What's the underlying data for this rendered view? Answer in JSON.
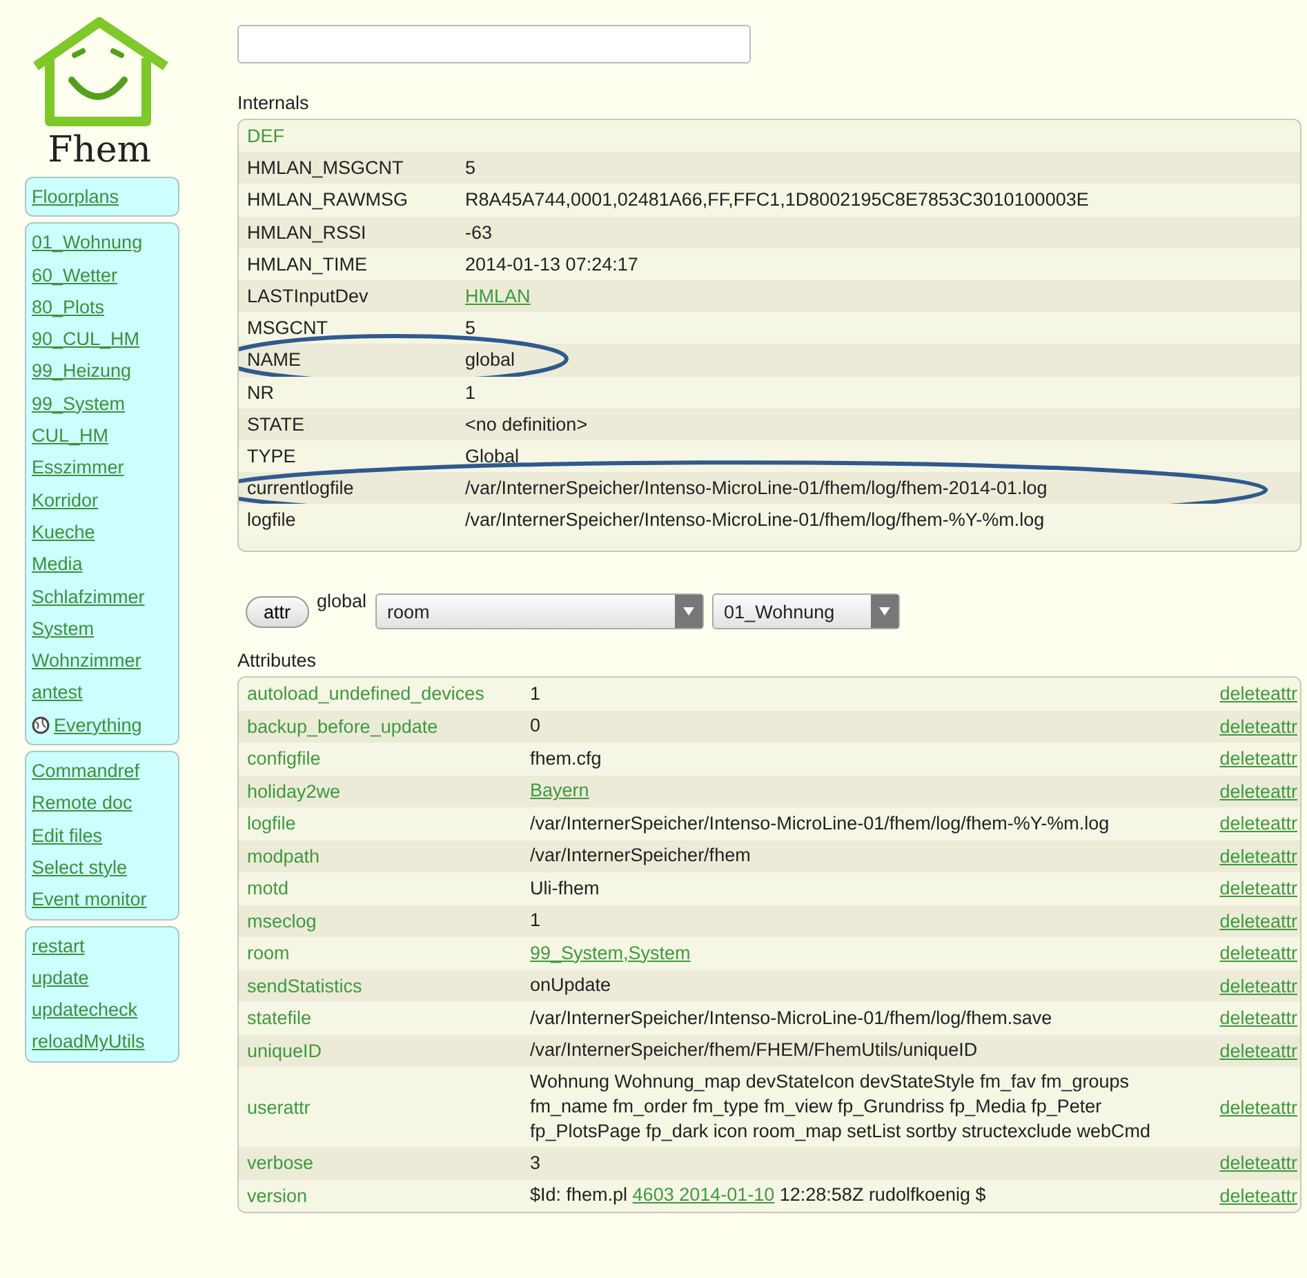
{
  "logo": {
    "text": "Fhem"
  },
  "menu_groups": [
    {
      "items": [
        "Floorplans"
      ]
    },
    {
      "items": [
        "01_Wohnung",
        "60_Wetter",
        "80_Plots",
        "90_CUL_HM",
        "99_Heizung",
        "99_System",
        "CUL_HM",
        "Esszimmer",
        "Korridor",
        "Kueche",
        "Media",
        "Schlafzimmer",
        "System",
        "Wohnzimmer",
        "antest"
      ],
      "everything": "Everything"
    },
    {
      "items": [
        "Commandref",
        "Remote doc",
        "Edit files",
        "Select style",
        "Event monitor"
      ]
    },
    {
      "items": [
        "restart",
        "update",
        "updatecheck",
        "reloadMyUtils"
      ]
    }
  ],
  "internals": {
    "title": "Internals",
    "rows": [
      {
        "name": "DEF",
        "kind": "definition",
        "circled": false
      },
      {
        "name": "HMLAN_MSGCNT",
        "value": "5",
        "kind": "plain",
        "circled": false
      },
      {
        "name": "HMLAN_RAWMSG",
        "value": "R8A45A744,0001,02481A66,FF,FFC1,1D8002195C8E7853C3010100003E",
        "kind": "plain",
        "circled": false
      },
      {
        "name": "HMLAN_RSSI",
        "value": "-63",
        "kind": "plain",
        "circled": false
      },
      {
        "name": "HMLAN_TIME",
        "value": "2014-01-13 07:24:17",
        "kind": "plain",
        "circled": false
      },
      {
        "name": "LASTInputDev",
        "value": "HMLAN",
        "kind": "link",
        "circled": false
      },
      {
        "name": "MSGCNT",
        "value": "5",
        "kind": "plain",
        "circled": false
      },
      {
        "name": "NAME",
        "value": "global",
        "kind": "plain",
        "circled": true
      },
      {
        "name": "NR",
        "value": "1",
        "kind": "plain",
        "circled": false
      },
      {
        "name": "STATE",
        "value": "<no definition>",
        "kind": "plain",
        "circled": false
      },
      {
        "name": "TYPE",
        "value": "Global",
        "kind": "plain",
        "circled": false
      },
      {
        "name": "currentlogfile",
        "value": "/var/InternerSpeicher/Intenso-MicroLine-01/fhem/log/fhem-2014-01.log",
        "kind": "plain",
        "circled": true
      },
      {
        "name": "logfile",
        "value": "/var/InternerSpeicher/Intenso-MicroLine-01/fhem/log/fhem-%Y-%m.log",
        "kind": "plain",
        "circled": false
      }
    ]
  },
  "attr_bar": {
    "button": "attr",
    "device": "global",
    "attribute": "room",
    "attribute_value": "01_Wohnung"
  },
  "attributes": {
    "title": "Attributes",
    "rows": [
      {
        "name": "autoload_undefined_devices",
        "value": "1",
        "kind": "plain",
        "action": "deleteattr"
      },
      {
        "name": "backup_before_update",
        "value": "0",
        "kind": "plain",
        "action": "deleteattr"
      },
      {
        "name": "configfile",
        "value": "fhem.cfg",
        "kind": "plain",
        "action": "deleteattr"
      },
      {
        "name": "holiday2we",
        "value": "Bayern",
        "kind": "link",
        "action": "deleteattr"
      },
      {
        "name": "logfile",
        "value": "/var/InternerSpeicher/Intenso-MicroLine-01/fhem/log/fhem-%Y-%m.log",
        "kind": "plain",
        "action": "deleteattr"
      },
      {
        "name": "modpath",
        "value": "/var/InternerSpeicher/fhem",
        "kind": "plain",
        "action": "deleteattr"
      },
      {
        "name": "motd",
        "value": "Uli-fhem",
        "kind": "plain",
        "action": "deleteattr"
      },
      {
        "name": "mseclog",
        "value": "1",
        "kind": "plain",
        "action": "deleteattr"
      },
      {
        "name": "room",
        "value": "99_System,System",
        "kind": "link",
        "action": "deleteattr"
      },
      {
        "name": "sendStatistics",
        "value": "onUpdate",
        "kind": "plain",
        "action": "deleteattr"
      },
      {
        "name": "statefile",
        "value": "/var/InternerSpeicher/Intenso-MicroLine-01/fhem/log/fhem.save",
        "kind": "plain",
        "action": "deleteattr"
      },
      {
        "name": "uniqueID",
        "value": "/var/InternerSpeicher/fhem/FHEM/FhemUtils/uniqueID",
        "kind": "plain",
        "action": "deleteattr"
      },
      {
        "name": "userattr",
        "value": "Wohnung Wohnung_map devStateIcon devStateStyle fm_fav fm_groups fm_name fm_order fm_type fm_view fp_Grundriss fp_Media fp_Peter fp_PlotsPage fp_dark icon room_map setList sortby structexclude webCmd",
        "kind": "plain",
        "action": "deleteattr"
      },
      {
        "name": "verbose",
        "value": "3",
        "kind": "plain",
        "action": "deleteattr"
      },
      {
        "name": "version",
        "kind": "revision",
        "value_parts": {
          "prefix": "$Id: fhem.pl",
          "link": "4603 2014-01-10",
          "suffix": "12:28:58Z rudolfkoenig $"
        },
        "action": "deleteattr"
      }
    ]
  }
}
